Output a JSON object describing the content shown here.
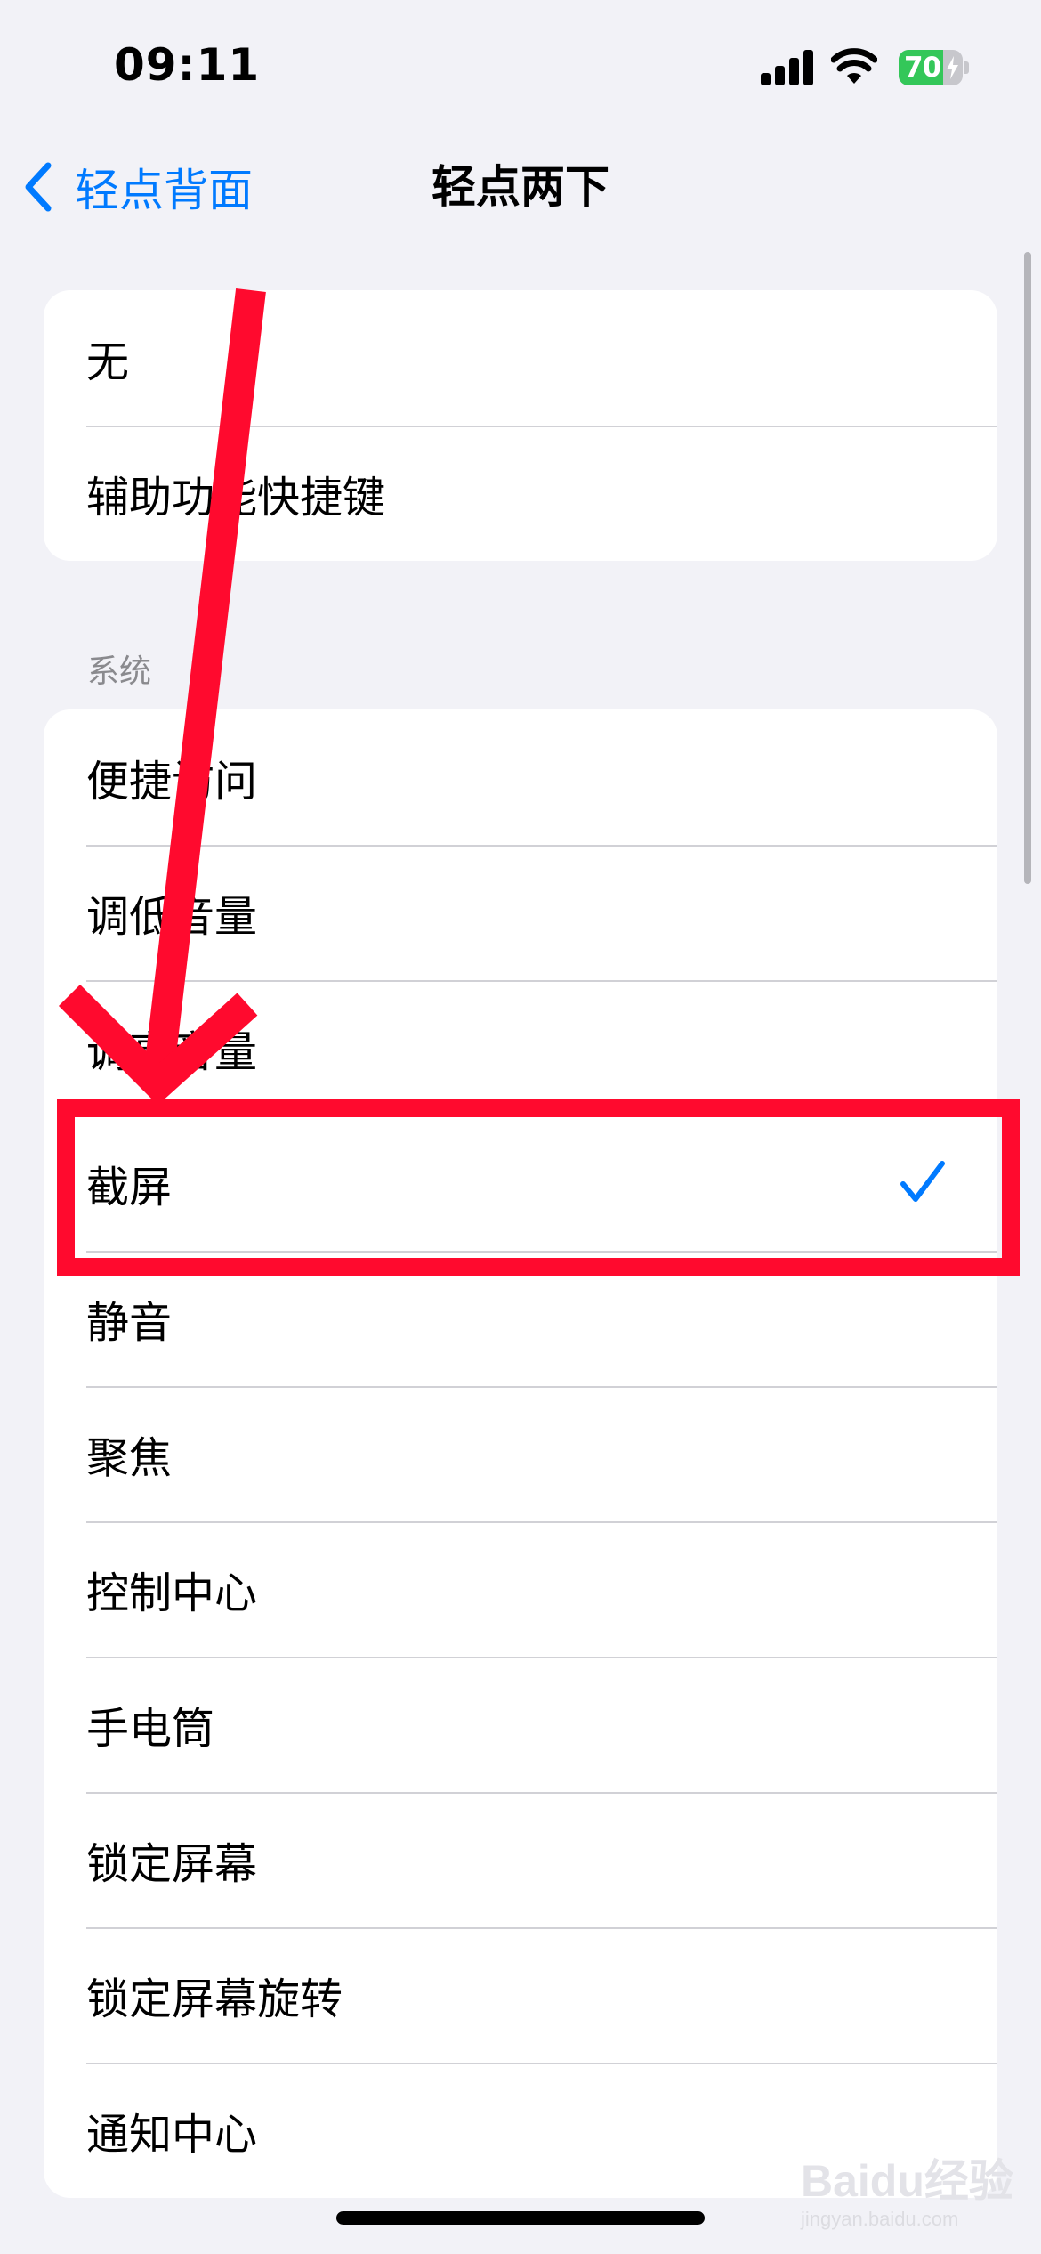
{
  "status_bar": {
    "time": "09:11",
    "battery_percent": "70",
    "battery_level": 0.7,
    "icons": [
      "cellular-signal-icon",
      "wifi-icon",
      "battery-charging-icon"
    ]
  },
  "nav": {
    "back_label": "轻点背面",
    "title": "轻点两下"
  },
  "group1": {
    "items": [
      {
        "label": "无"
      },
      {
        "label": "辅助功能快捷键"
      }
    ]
  },
  "system_header": "系统",
  "system": {
    "items": [
      {
        "label": "便捷访问",
        "selected": false
      },
      {
        "label": "调低音量",
        "selected": false
      },
      {
        "label": "调高音量",
        "selected": false
      },
      {
        "label": "截屏",
        "selected": true
      },
      {
        "label": "静音",
        "selected": false
      },
      {
        "label": "聚焦",
        "selected": false
      },
      {
        "label": "控制中心",
        "selected": false
      },
      {
        "label": "手电筒",
        "selected": false
      },
      {
        "label": "锁定屏幕",
        "selected": false
      },
      {
        "label": "锁定屏幕旋转",
        "selected": false
      },
      {
        "label": "通知中心",
        "selected": false
      }
    ]
  },
  "watermark": {
    "logo": "Baidu经验",
    "url": "jingyan.baidu.com"
  },
  "colors": {
    "accent": "#007aff",
    "background": "#f2f2f7",
    "battery_green": "#34c759",
    "annotation_red": "#ff0a2e"
  }
}
